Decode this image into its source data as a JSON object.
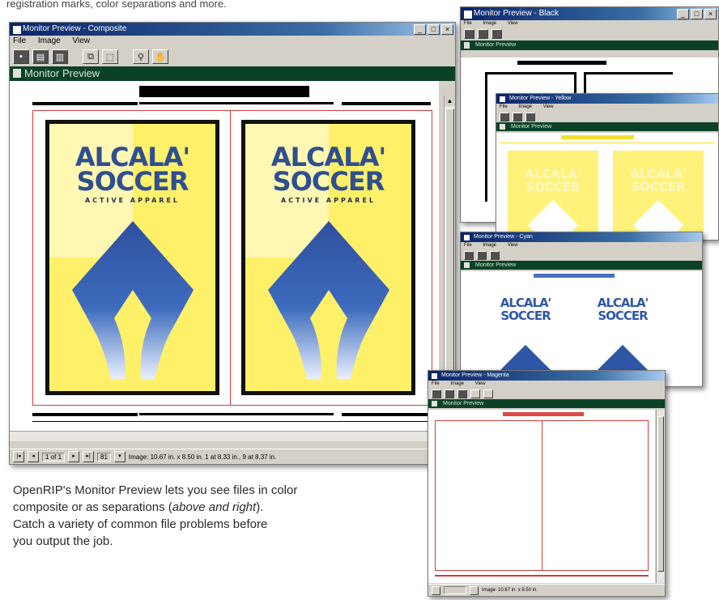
{
  "top_caption": "registration marks, color separations and more.",
  "main_window": {
    "title": "Monitor Preview - Composite",
    "menu": [
      "File",
      "Image",
      "View"
    ],
    "panel_title": "Monitor Preview",
    "logo_line1": "ALCALA'",
    "logo_line2": "SOCCER",
    "logo_line3": "ACTIVE APPAREL",
    "status_page": "1 of 1",
    "status_zoom": "81",
    "status_info": "Image: 10.67 in. x 8.50 in. 1 at 8.33 in., 9 at 8.37 in."
  },
  "win_back1": {
    "title": "Monitor Preview - Black",
    "panel_title": "Monitor Preview"
  },
  "win_back2": {
    "title": "Monitor Preview - Yellow",
    "panel_title": "Monitor Preview",
    "logo_line1": "ALCALA'",
    "logo_line2": "SOCCER"
  },
  "win_back3": {
    "title": "Monitor Preview - Cyan",
    "panel_title": "Monitor Preview",
    "logo_line1": "ALCALA'",
    "logo_line2": "SOCCER"
  },
  "win_front": {
    "title": "Monitor Preview - Magenta",
    "panel_title": "Monitor Preview",
    "status_info": "Image: 10.67 in. x 8.50 in."
  },
  "caption": {
    "line1": "OpenRIP's Monitor Preview lets you see files in color",
    "line2a": "composite or as separations (",
    "line2b": "above and right",
    "line2c": ").",
    "line3": "Catch a variety of common file problems before",
    "line4": "you output the job."
  },
  "colors": {
    "panel_green": "#0b4226",
    "logo_blue": "#2f4f8f",
    "logo_yellow": "#fff06a",
    "reg_red": "#d23c3c"
  },
  "icons": [
    "app-icon",
    "minimize-icon",
    "maximize-icon",
    "close-icon",
    "zoom-icon",
    "hand-icon",
    "scroll-arrow-icon"
  ]
}
